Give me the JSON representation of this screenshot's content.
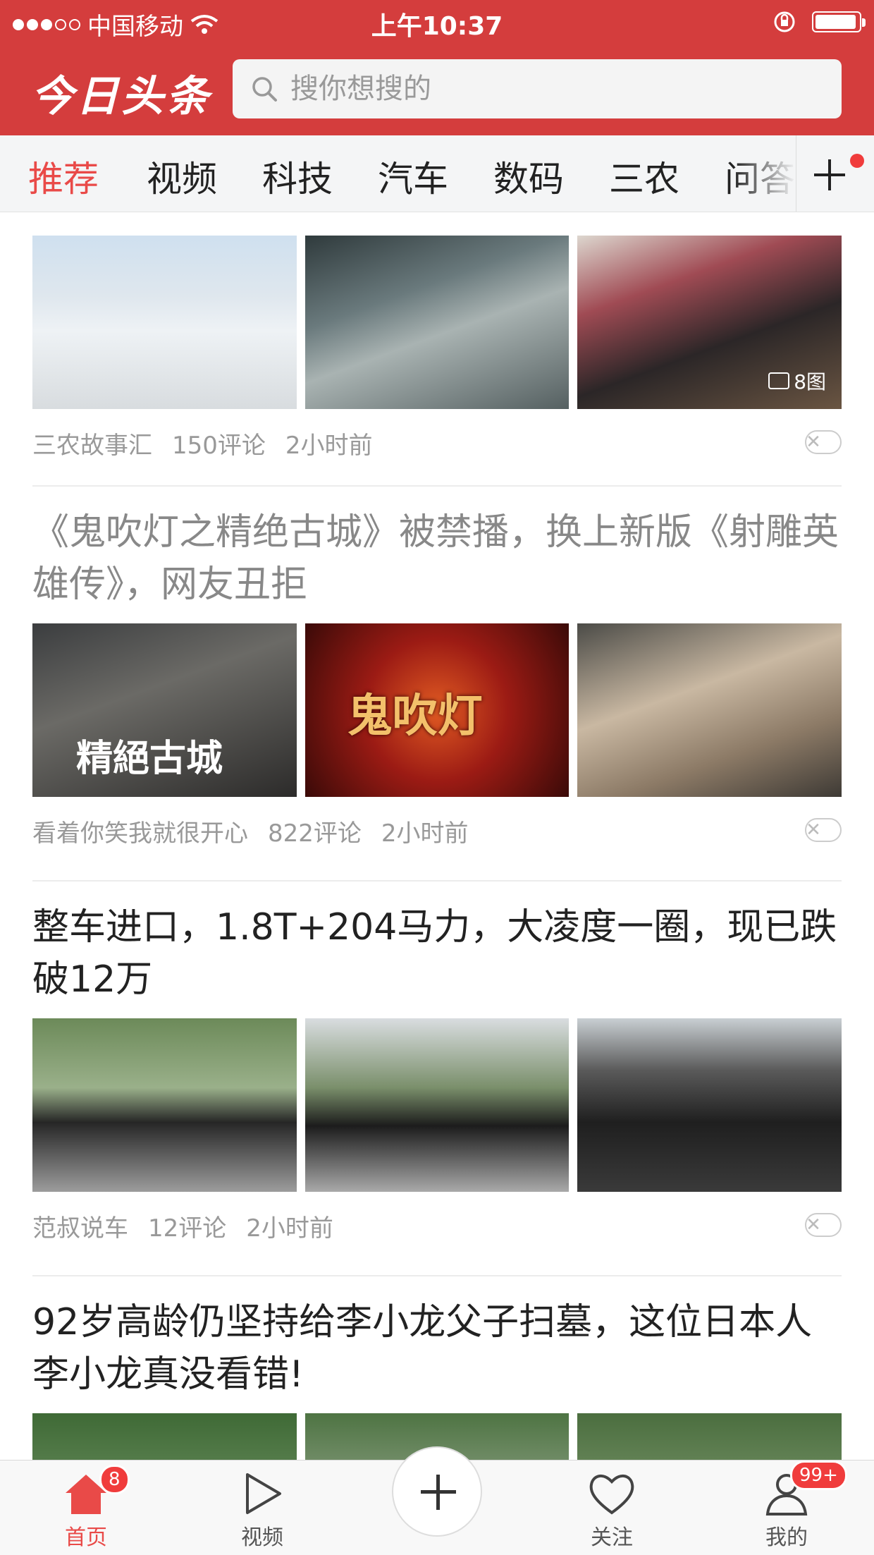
{
  "status_bar": {
    "carrier": "中国移动",
    "time": "上午10:37",
    "signal_bars_filled": 3,
    "signal_bars_total": 5,
    "battery_level": 0.95
  },
  "header": {
    "logo": "今日头条",
    "search_placeholder": "搜你想搜的"
  },
  "tabs": [
    {
      "label": "推荐",
      "active": true
    },
    {
      "label": "视频",
      "active": false
    },
    {
      "label": "科技",
      "active": false
    },
    {
      "label": "汽车",
      "active": false
    },
    {
      "label": "数码",
      "active": false
    },
    {
      "label": "三农",
      "active": false
    },
    {
      "label": "问答",
      "active": false
    }
  ],
  "articles": [
    {
      "images_badge": "8图",
      "source": "三农故事汇",
      "comments": "150评论",
      "time": "2小时前"
    },
    {
      "title": "《鬼吹灯之精绝古城》被禁播，换上新版《射雕英雄传》，网友丑拒",
      "image_caption": "精絕古城",
      "image_logo": "鬼吹灯",
      "source": "看着你笑我就很开心",
      "comments": "822评论",
      "time": "2小时前"
    },
    {
      "title": "整车进口，1.8T+204马力，大凌度一圈，现已跌破12万",
      "source": "范叔说车",
      "comments": "12评论",
      "time": "2小时前"
    },
    {
      "title": "92岁高龄仍坚持给李小龙父子扫墓，这位日本人李小龙真没看错!"
    }
  ],
  "tabbar": {
    "home": {
      "label": "首页",
      "badge": "8"
    },
    "video": {
      "label": "视频"
    },
    "follow": {
      "label": "关注"
    },
    "me": {
      "label": "我的",
      "badge": "99+"
    }
  },
  "colors": {
    "brand_red": "#d43d3d",
    "active_tab": "#e94a48",
    "badge_red": "#f03c3c"
  }
}
